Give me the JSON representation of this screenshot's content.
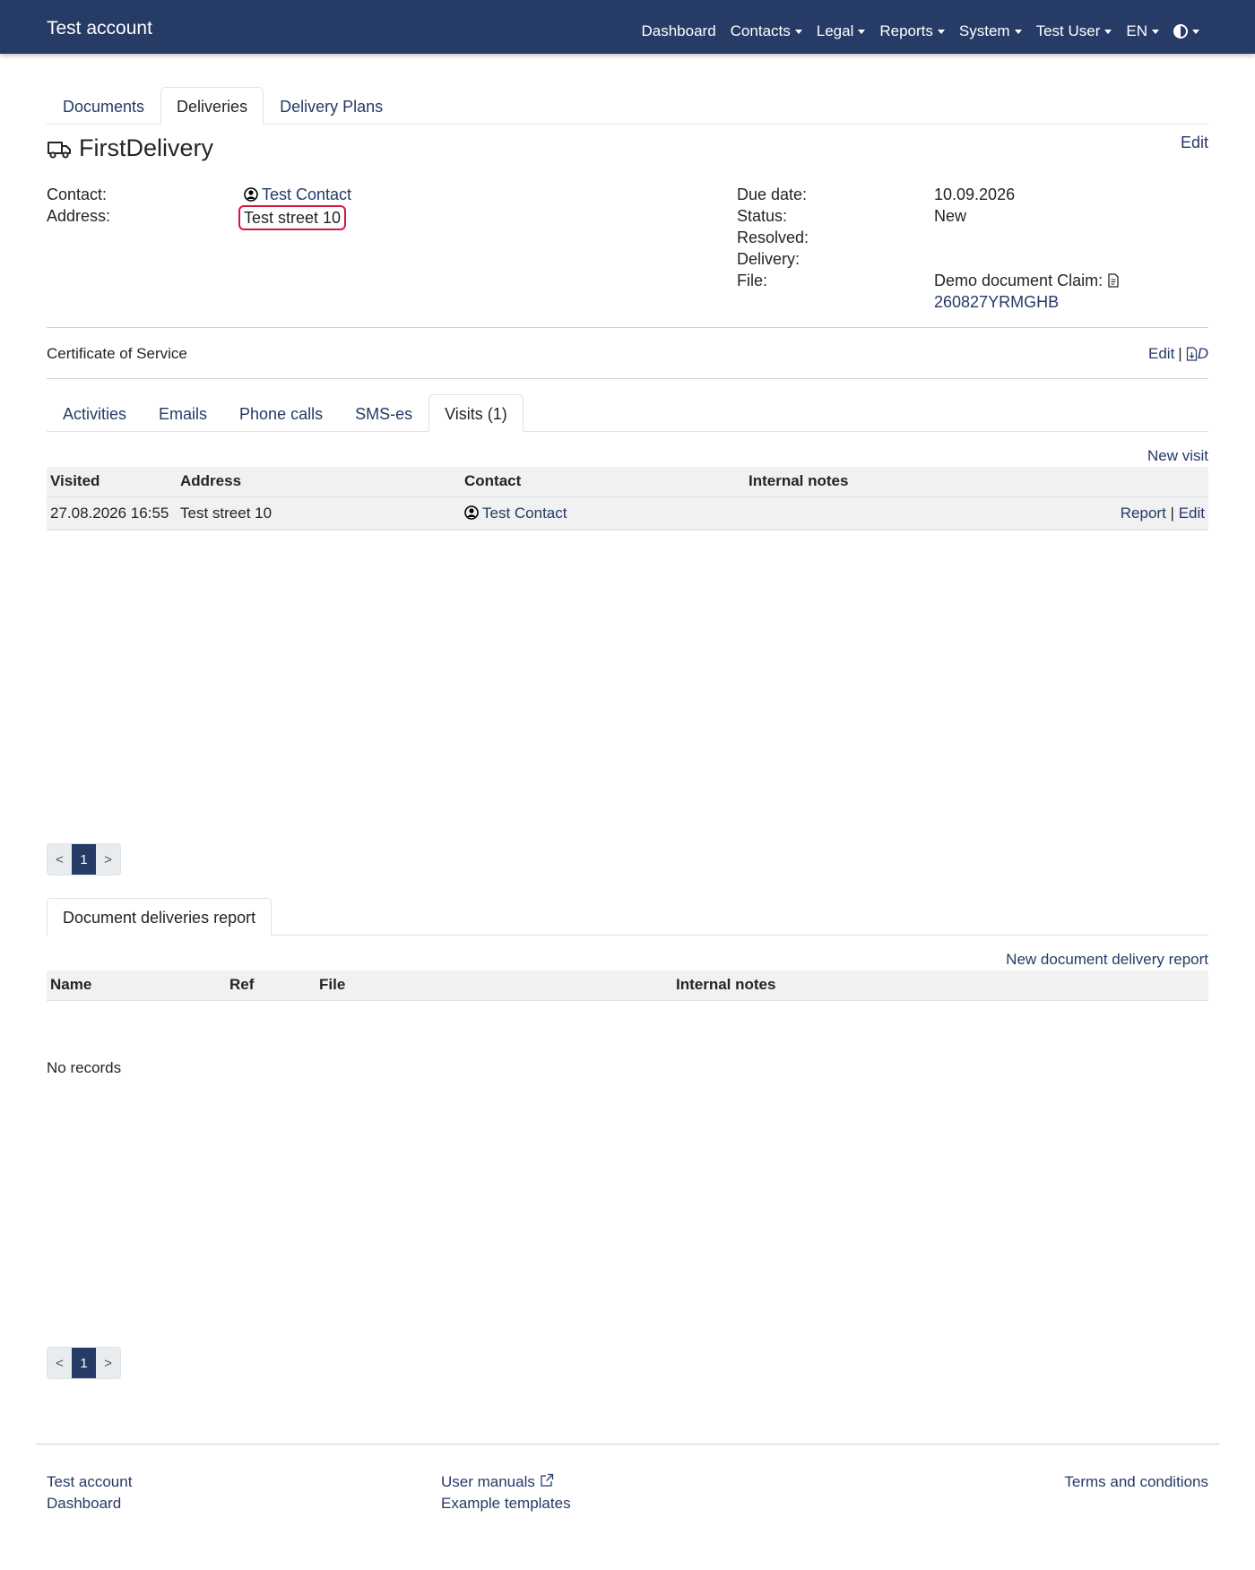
{
  "navbar": {
    "brand": "Test account",
    "items": [
      "Dashboard",
      "Contacts",
      "Legal",
      "Reports",
      "System",
      "Test User",
      "EN"
    ]
  },
  "top_tabs": [
    "Documents",
    "Deliveries",
    "Delivery Plans"
  ],
  "delivery": {
    "title": "FirstDelivery",
    "edit": "Edit",
    "contact_label": "Contact:",
    "contact_value": "Test Contact",
    "address_label": "Address:",
    "address_value": "Test street 10",
    "due_label": "Due date:",
    "due_value": "10.09.2026",
    "status_label": "Status:",
    "status_value": "New",
    "resolved_label": "Resolved:",
    "delivery_label": "Delivery:",
    "file_label": "File:",
    "file_value_prefix": "Demo document Claim:",
    "file_link": "260827YRMGHB"
  },
  "certificate": {
    "title": "Certificate of Service",
    "edit": "Edit",
    "separator": "|",
    "d": "D"
  },
  "sub_tabs": [
    "Activities",
    "Emails",
    "Phone calls",
    "SMS-es",
    "Visits (1)"
  ],
  "visits": {
    "new_link": "New visit",
    "columns": [
      "Visited",
      "Address",
      "Contact",
      "Internal notes"
    ],
    "rows": [
      {
        "visited": "27.08.2026 16:55",
        "address": "Test street 10",
        "contact": "Test Contact",
        "report": "Report",
        "sep": "|",
        "edit": "Edit"
      }
    ]
  },
  "pager": {
    "prev": "<",
    "page": "1",
    "next": ">"
  },
  "report_tab": "Document deliveries report",
  "reports": {
    "new_link": "New document delivery report",
    "columns": [
      "Name",
      "Ref",
      "File",
      "Internal notes"
    ],
    "empty": "No records"
  },
  "footer": {
    "col1": [
      "Test account",
      "Dashboard"
    ],
    "col2": [
      "User manuals",
      "Example templates"
    ],
    "col3": [
      "Terms and conditions"
    ]
  }
}
